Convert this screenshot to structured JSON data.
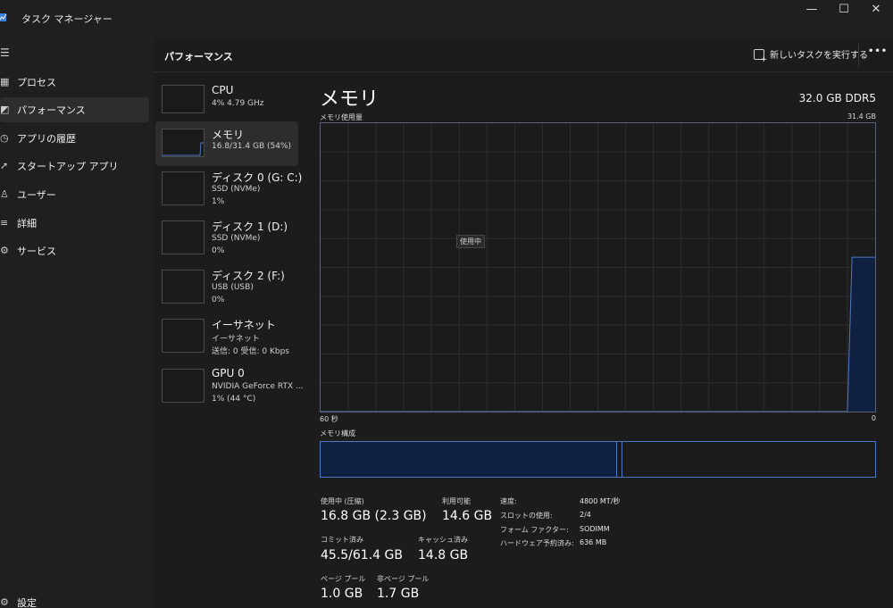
{
  "window": {
    "title": "タスク マネージャー",
    "controls": [
      "—",
      "☐",
      "✕"
    ]
  },
  "nav": {
    "items": [
      {
        "label": "プロセス",
        "icon": "processes-icon",
        "selected": false
      },
      {
        "label": "パフォーマンス",
        "icon": "performance-icon",
        "selected": true
      },
      {
        "label": "アプリの履歴",
        "icon": "app-history-icon",
        "selected": false
      },
      {
        "label": "スタートアップ アプリ",
        "icon": "startup-icon",
        "selected": false
      },
      {
        "label": "ユーザー",
        "icon": "users-icon",
        "selected": false
      },
      {
        "label": "詳細",
        "icon": "details-icon",
        "selected": false
      },
      {
        "label": "サービス",
        "icon": "services-icon",
        "selected": false
      }
    ],
    "settings": "設定"
  },
  "header": {
    "title": "パフォーマンス",
    "run_task": "新しいタスクを実行する",
    "more": "•••"
  },
  "perf_list": [
    {
      "name": "CPU",
      "sub1": "4%  4.79 GHz",
      "sub2": "",
      "selected": false
    },
    {
      "name": "メモリ",
      "sub1": "16.8/31.4 GB (54%)",
      "sub2": "",
      "selected": true
    },
    {
      "name": "ディスク 0 (G: C:)",
      "sub1": "SSD (NVMe)",
      "sub2": "1%",
      "selected": false
    },
    {
      "name": "ディスク 1 (D:)",
      "sub1": "SSD (NVMe)",
      "sub2": "0%",
      "selected": false
    },
    {
      "name": "ディスク 2 (F:)",
      "sub1": "USB (USB)",
      "sub2": "0%",
      "selected": false
    },
    {
      "name": "イーサネット",
      "sub1": "イーサネット",
      "sub2": "送信: 0 受信: 0 Kbps",
      "selected": false
    },
    {
      "name": "GPU 0",
      "sub1": "NVIDIA GeForce RTX ...",
      "sub2": "1% (44 °C)",
      "selected": false
    }
  ],
  "detail": {
    "title": "メモリ",
    "spec": "32.0 GB DDR5",
    "graph_label": "メモリ使用量",
    "graph_max": "31.4 GB",
    "time_left": "60 秒",
    "time_right": "0",
    "inuse_tag": "使用中",
    "composition_label": "メモリ構成",
    "composition": {
      "in_use_fraction": 0.535,
      "modified_fraction": 0.545
    }
  },
  "chart_data": {
    "type": "area",
    "title": "メモリ使用量",
    "xlabel": "",
    "ylabel": "",
    "x_range_seconds": [
      60,
      0
    ],
    "ylim_gb": [
      0,
      31.4
    ],
    "x": [
      60,
      3,
      2.5,
      0
    ],
    "y": [
      0,
      0,
      16.8,
      16.8
    ],
    "grid": true,
    "color": "#4e78c4",
    "fill": "#102040"
  },
  "stats": {
    "in_use_label": "使用中 (圧縮)",
    "in_use_value": "16.8 GB (2.3 GB)",
    "available_label": "利用可能",
    "available_value": "14.6 GB",
    "committed_label": "コミット済み",
    "committed_value": "45.5/61.4 GB",
    "cached_label": "キャッシュ済み",
    "cached_value": "14.8 GB",
    "paged_label": "ページ プール",
    "paged_value": "1.0 GB",
    "nonpaged_label": "非ページ プール",
    "nonpaged_value": "1.7 GB"
  },
  "specs": [
    {
      "key": "速度:",
      "value": "4800 MT/秒"
    },
    {
      "key": "スロットの使用:",
      "value": "2/4"
    },
    {
      "key": "フォーム ファクター:",
      "value": "SODIMM"
    },
    {
      "key": "ハードウェア予約済み:",
      "value": "636 MB"
    }
  ],
  "colors": {
    "accent": "#4e78c4",
    "fill": "#102040",
    "background": "#1c1c1c"
  }
}
